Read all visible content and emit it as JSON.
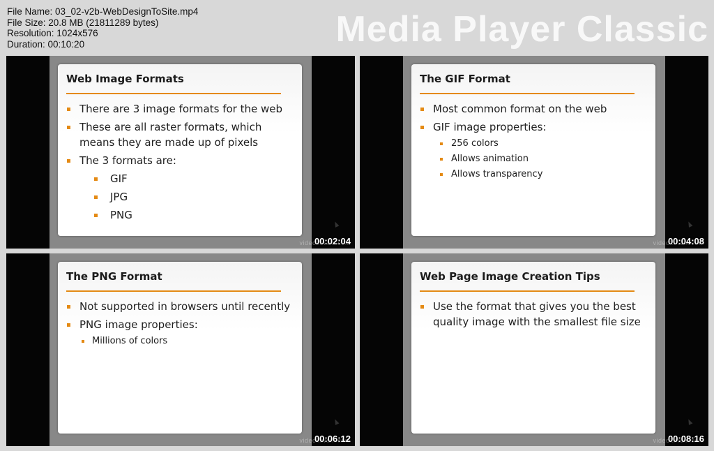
{
  "file_info": {
    "name": "File Name: 03_02-v2b-WebDesignToSite.mp4",
    "size": "File Size: 20.8 MB (21811289 bytes)",
    "resolution": "Resolution: 1024x576",
    "duration": "Duration: 00:10:20"
  },
  "brand": "Media Player Classic",
  "accent_color": "#e48a14",
  "watermark": "video2brain.com",
  "thumbnails": [
    {
      "timestamp": "00:02:04",
      "title": "Web Image Formats",
      "bullets": [
        {
          "text": "There are 3 image formats for the web"
        },
        {
          "text": "These are all raster formats, which means they are made up of pixels"
        },
        {
          "text": "The 3 formats are:"
        }
      ],
      "sub_bullets": [
        "GIF",
        "JPG",
        "PNG"
      ]
    },
    {
      "timestamp": "00:04:08",
      "title": "The GIF Format",
      "bullets": [
        {
          "text": "Most common format on the web"
        },
        {
          "text": "GIF image properties:"
        }
      ],
      "sub_bullets": [
        "256 colors",
        "Allows animation",
        "Allows transparency"
      ]
    },
    {
      "timestamp": "00:06:12",
      "title": "The PNG Format",
      "bullets": [
        {
          "text": "Not supported in browsers until recently"
        },
        {
          "text": "PNG image properties:"
        }
      ],
      "sub_bullets": [
        "Millions of colors"
      ]
    },
    {
      "timestamp": "00:08:16",
      "title": "Web Page Image Creation Tips",
      "bullets": [
        {
          "text": "Use the format that gives you the best quality image with the smallest file size"
        }
      ],
      "sub_bullets": []
    }
  ]
}
